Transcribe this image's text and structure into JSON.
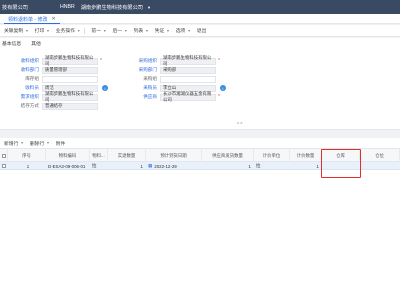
{
  "topbar": {
    "company": "技有限公司",
    "org_code": "HNBR",
    "org_name": "湖南步鹏生物科技有限公司",
    "caret": "▼"
  },
  "tab": {
    "label": "领料退料单 - 修改",
    "close": "✕"
  },
  "toolbar": {
    "items": [
      {
        "label": "关联复制",
        "dropdown": true
      },
      {
        "label": "打印",
        "dropdown": true
      },
      {
        "label": "业务操作",
        "dropdown": true
      },
      {
        "label": "前一",
        "dropdown": true
      },
      {
        "label": "后一",
        "dropdown": true
      },
      {
        "label": "列表",
        "dropdown": true
      },
      {
        "label": "凭证",
        "dropdown": true
      },
      {
        "label": "选项",
        "dropdown": true
      },
      {
        "label": "退出",
        "dropdown": false
      }
    ]
  },
  "subtabs": [
    "基本信息",
    "其他"
  ],
  "form": {
    "left": [
      {
        "label": "收料组织",
        "value": "湖南步鹏生物科技有限公司",
        "blue": true,
        "required": true
      },
      {
        "label": "收料部门",
        "value": "质量管理部",
        "blue": true,
        "required": false
      },
      {
        "label": "库存组",
        "value": "",
        "blue": false,
        "required": false
      },
      {
        "label": "收料员",
        "value": "周洁",
        "blue": true,
        "required": false
      },
      {
        "label": "需求组织",
        "value": "湖南步鹏生物科技有限公司",
        "blue": true,
        "required": false
      },
      {
        "label": "结存方式",
        "value": "普通结存",
        "blue": false,
        "required": false
      }
    ],
    "right": [
      {
        "label": "采购组织",
        "value": "湖南步鹏生物科技有限公司",
        "blue": true,
        "required": true
      },
      {
        "label": "采购部门",
        "value": "采购部",
        "blue": true,
        "required": false
      },
      {
        "label": "采购组",
        "value": "",
        "blue": false,
        "required": false
      },
      {
        "label": "采购员",
        "value": "李立山",
        "blue": true,
        "required": false
      },
      {
        "label": "供应商",
        "value": "长沙市湘湖仪器五金有限公司",
        "blue": true,
        "required": true
      }
    ]
  },
  "collapse_chevron": "⌃⌃",
  "grid_toolbar": {
    "items": [
      {
        "label": "新增行",
        "dropdown": true
      },
      {
        "label": "删除行",
        "dropdown": true
      },
      {
        "label": "附件",
        "dropdown": false
      }
    ]
  },
  "grid": {
    "headers": [
      "",
      "序号",
      "物料编码",
      "物料...",
      "实退数量",
      "预计到货日期",
      "供应商发货数量",
      "计价单位",
      "计价数量",
      "仓库",
      "仓位"
    ],
    "rows": [
      {
        "seq": "1",
        "code": "D-ESA3-09-006-01",
        "name": "拉",
        "qty": "1",
        "date": "2022-12-29",
        "supplier_qty": "1",
        "unit": "拉",
        "price_qty": "1",
        "warehouse": "",
        "location": ""
      }
    ]
  },
  "colors": {
    "topbar": "#3b4a63",
    "accent": "#2d6cdf",
    "highlight": "#e0302a"
  }
}
